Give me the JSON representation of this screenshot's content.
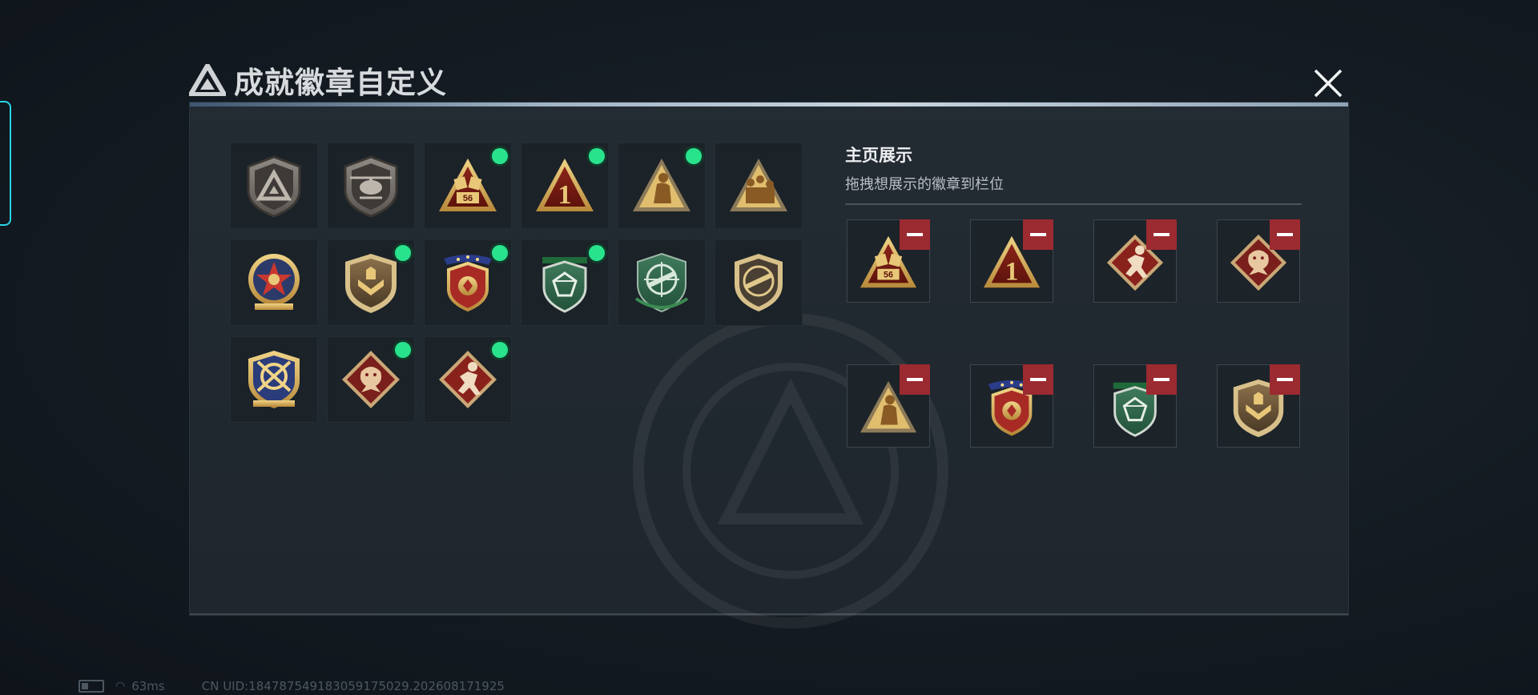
{
  "window": {
    "title": "成就徽章自定义",
    "close_icon": "close-x-icon"
  },
  "colors": {
    "accent_tab": "#29d4e8",
    "new_indicator": "#29e38c",
    "remove_button": "#9c2a31",
    "panel_bg": "#232b33"
  },
  "badge_collection": {
    "items": [
      {
        "icon": "grey-shield-triangle-logo-badge",
        "is_new": false
      },
      {
        "icon": "grey-shield-helicopter-badge",
        "is_new": false
      },
      {
        "icon": "triangle-dice-56-badge",
        "is_new": true
      },
      {
        "icon": "triangle-number-one-badge",
        "is_new": true
      },
      {
        "icon": "triangle-soldier-crouch-badge",
        "is_new": true
      },
      {
        "icon": "triangle-squad-soldiers-badge",
        "is_new": false
      },
      {
        "icon": "gold-star-medal-badge",
        "is_new": false
      },
      {
        "icon": "bronze-chevron-shield-badge",
        "is_new": true
      },
      {
        "icon": "red-laurel-stars-shield-badge",
        "is_new": true
      },
      {
        "icon": "green-diamond-shield-badge",
        "is_new": true
      },
      {
        "icon": "green-crosshair-rifle-badge",
        "is_new": false
      },
      {
        "icon": "bronze-rifle-shield-badge",
        "is_new": false
      },
      {
        "icon": "gold-crosshair-swords-shield-badge",
        "is_new": false
      },
      {
        "icon": "diamond-dragon-badge",
        "is_new": true
      },
      {
        "icon": "diamond-running-soldier-badge",
        "is_new": true
      }
    ]
  },
  "display_section": {
    "title": "主页展示",
    "subtitle": "拖拽想展示的徽章到栏位",
    "slots": [
      {
        "icon": "triangle-dice-56-badge",
        "action_icon": "remove-minus-icon"
      },
      {
        "icon": "triangle-number-one-badge",
        "action_icon": "remove-minus-icon"
      },
      {
        "icon": "diamond-running-soldier-badge",
        "action_icon": "remove-minus-icon"
      },
      {
        "icon": "diamond-dragon-badge",
        "action_icon": "remove-minus-icon"
      },
      {
        "icon": "triangle-soldier-crouch-badge",
        "action_icon": "remove-minus-icon"
      },
      {
        "icon": "red-laurel-stars-shield-badge",
        "action_icon": "remove-minus-icon"
      },
      {
        "icon": "green-diamond-shield-badge",
        "action_icon": "remove-minus-icon"
      },
      {
        "icon": "bronze-chevron-shield-badge",
        "action_icon": "remove-minus-icon"
      }
    ]
  },
  "status_bar": {
    "battery_icon": "battery-icon",
    "wifi_icon": "wifi-icon",
    "latency": "63ms",
    "uid": "CN UID:184787549183059175029.202608171925"
  }
}
